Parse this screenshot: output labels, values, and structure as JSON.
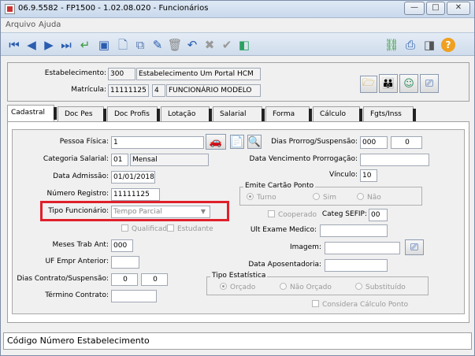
{
  "window": {
    "title": "06.9.5582 - FP1500 - 1.02.08.020 - Funcionários",
    "controls": [
      "—",
      "□",
      "✕"
    ]
  },
  "menu": [
    "Arquivo",
    "Ajuda"
  ],
  "toolbar": {
    "left_icons": [
      "first-record-icon",
      "previous-record-icon",
      "next-record-icon",
      "last-record-icon",
      "return-icon",
      "view-icon",
      "new-icon",
      "copy-icon",
      "edit-icon",
      "delete-icon",
      "undo-icon",
      "cancel-icon",
      "confirm-icon",
      "clear-icon"
    ],
    "right_icons": [
      "network-icon",
      "print-icon",
      "exit-icon",
      "help-icon"
    ]
  },
  "header": {
    "estabelecimento_label": "Estabelecimento:",
    "estabelecimento_code": "300",
    "estabelecimento_name": "Estabelecimento Um Portal HCM",
    "matricula_label": "Matrícula:",
    "matricula_value": "11111125",
    "matricula_digit": "4",
    "funcionario_name": "FUNCIONÁRIO MODELO"
  },
  "tabs": [
    "Cadastral",
    "Doc Pes",
    "Doc Profis",
    "Lotação",
    "Salarial",
    "Forma Pgto",
    "Cálculo",
    "Fgts/Inss"
  ],
  "form": {
    "pessoa_fisica_label": "Pessoa Física:",
    "pessoa_fisica_value": "1",
    "categoria_label": "Categoria Salarial:",
    "categoria_code": "01",
    "categoria_name": "Mensal",
    "admissao_label": "Data Admissão:",
    "admissao_value": "01/01/2018",
    "registro_label": "Número Registro:",
    "registro_value": "11111125",
    "tipo_label": "Tipo Funcionário:",
    "tipo_value": "Tempo Parcial",
    "qualificado_label": "Qualificado",
    "estudante_label": "Estudante",
    "meses_label": "Meses Trab Ant:",
    "meses_value": "000",
    "uf_label": "UF Empr Anterior:",
    "uf_value": "",
    "dias_contrato_label": "Dias Contrato/Suspensão:",
    "dias_contrato_1": "0",
    "dias_contrato_2": "0",
    "termino_label": "Término Contrato:",
    "termino_value": "",
    "dias_prorrog_label": "Dias Prorrog/Suspensão:",
    "dias_prorrog_1": "000",
    "dias_prorrog_2": "0",
    "venc_prorrog_label": "Data Vencimento Prorrogação:",
    "vinculo_label": "Vínculo:",
    "vinculo_value": "10",
    "emite_cartao_title": "Emite Cartão Ponto",
    "turno_label": "Turno",
    "sim_label": "Sim",
    "nao_label": "Não",
    "cooperado_label": "Cooperado",
    "categ_sefip_label": "Categ SEFIP:",
    "categ_sefip_value": "00",
    "ult_exame_label": "Ult Exame Medico:",
    "imagem_label": "Imagem:",
    "aposentadoria_label": "Data Aposentadoria:",
    "tipo_estatistica_title": "Tipo Estatística",
    "orcado_label": "Orçado",
    "nao_orcado_label": "Não Orçado",
    "substituido_label": "Substituído",
    "considera_calculo_label": "Considera Cálculo Ponto"
  },
  "status": "Código Número Estabelecimento"
}
